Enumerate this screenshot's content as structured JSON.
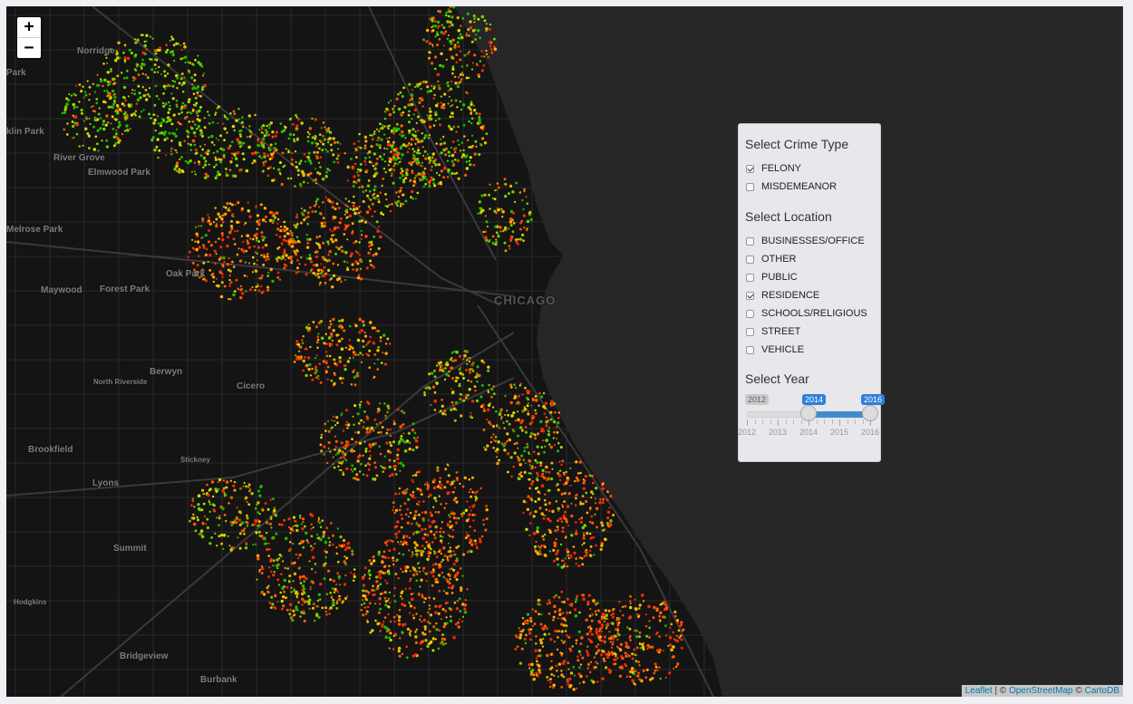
{
  "map": {
    "zoom_in": "+",
    "zoom_out": "−",
    "places": [
      "Norridge",
      "Park",
      "klin Park",
      "River Grove",
      "Elmwood Park",
      "Melrose Park",
      "Oak Park",
      "Maywood",
      "Forest Park",
      "Berwyn",
      "North Riverside",
      "Cicero",
      "Brookfield",
      "Stickney",
      "Lyons",
      "Summit",
      "Hodgkins",
      "Bridgeview",
      "Burbank",
      "CHICAGO"
    ],
    "attribution": {
      "leaflet": "Leaflet",
      "sep1": " | © ",
      "osm": "OpenStreetMap",
      "sep2": " © ",
      "carto": "CartoDB"
    },
    "point_colors": [
      "#ff2a00",
      "#ff5a00",
      "#ffae00",
      "#d7d700",
      "#6fd200",
      "#1fb800"
    ]
  },
  "panel": {
    "crime_title": "Select Crime Type",
    "crime_types": [
      {
        "label": "FELONY",
        "checked": true
      },
      {
        "label": "MISDEMEANOR",
        "checked": false
      }
    ],
    "location_title": "Select Location",
    "locations": [
      {
        "label": "BUSINESSES/OFFICE",
        "checked": false
      },
      {
        "label": "OTHER",
        "checked": false
      },
      {
        "label": "PUBLIC",
        "checked": false
      },
      {
        "label": "RESIDENCE",
        "checked": true
      },
      {
        "label": "SCHOOLS/RELIGIOUS",
        "checked": false
      },
      {
        "label": "STREET",
        "checked": false
      },
      {
        "label": "VEHICLE",
        "checked": false
      }
    ],
    "year_title": "Select Year",
    "year_slider": {
      "min": 2012,
      "max": 2016,
      "from": 2014,
      "to": 2016,
      "min_label": "2012",
      "from_label": "2014",
      "to_label": "2016",
      "tick_labels": [
        "2012",
        "2013",
        "2014",
        "2015",
        "2016"
      ]
    }
  }
}
